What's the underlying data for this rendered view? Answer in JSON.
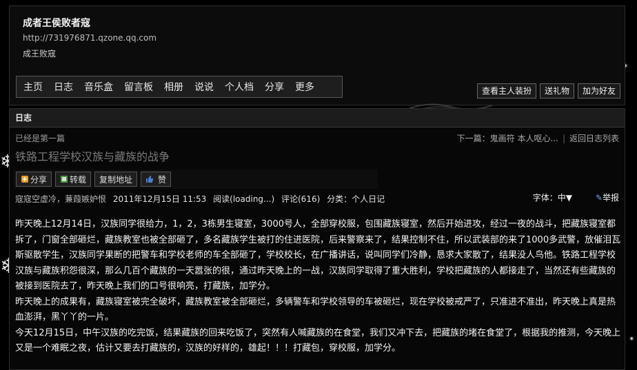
{
  "header": {
    "title": "成者王侯败者寇",
    "url": "http://731976871.qzone.qq.com",
    "subtitle": "成王败寇",
    "nav": [
      "主页",
      "日志",
      "音乐盒",
      "留言板",
      "相册",
      "说说",
      "个人档",
      "分享",
      "更多"
    ],
    "buttons": [
      "查看主人装扮",
      "送礼物",
      "加为好友"
    ]
  },
  "blog": {
    "section_title": "日志",
    "prev_note": "已经是第一篇",
    "next_link": "下一篇：鬼画符 本人呕心...",
    "back_link": "返回日志列表",
    "title": "铁路工程学校汉族与藏族的战争",
    "actions": [
      "分享",
      "转载",
      "复制地址",
      "赞"
    ],
    "meta": {
      "author": "寇寇空虚冷，蒹葭嫉妒恨",
      "date": "2011年12月15日 11:53",
      "reads": "阅读(loading...)",
      "comments": "评论(616)",
      "category": "分类：个人日记"
    },
    "font_label": "字体：中▼",
    "report_label": "举报",
    "paragraphs": [
      " 昨天晚上12月14日，汉族同学很给力，1，2，3栋男生寝室，3000号人，全部穿校服，包围藏族寝室，然后开始进攻，经过一夜的战斗，把藏族寝室都拆了，门窗全部砸烂，藏族教室也被全部砸了，多名藏族学生被打的住进医院，后来警察来了，结果控制不住，所以武装部的来了1000多武警，放催泪瓦斯驱散学生，汉族同学果断的把警车和学校老师的车全部砸了，学校校长，在广播讲话，说叫同学们冷静，恳求大家散了，结果没人鸟他。铁路工程学校汉族与藏族积怨很深，那么几百个藏族的一天嚣张的很，通过昨天晚上的一战，汉族同学取得了重大胜利，学校把藏族的人都接走了，当然还有些藏族的被接到医院去了，昨天晚上我们的口号很响亮，打藏族，加学分。",
      " 昨天晚上的成果有，藏族寝室被完全破坏，藏族教室被全部砸烂，多辆警车和学校领导的车被砸烂，现在学校被戒严了，只准进不准出，昨天晚上真是热血澎湃，黑丫丫的一片。",
      " 今天12月15日，中午汉族的吃完饭，结果藏族的回来吃饭了，突然有人喊藏族的在食堂，我们又冲下去，把藏族的堵在食堂了，根据我的推测，今天晚上又是一个难眠之夜，估计又要去打藏族的，汉族的好样的，雄起！！！打藏包，穿校服，加学分。"
    ]
  },
  "colors": {
    "background": "#000000",
    "panel": "#0c0c0c",
    "text": "#f2f2f2",
    "title_gray": "#7a7a7a"
  },
  "icons": [
    "snowflake-icon",
    "share-icon",
    "repost-icon",
    "thumbs-up-icon",
    "report-icon"
  ]
}
